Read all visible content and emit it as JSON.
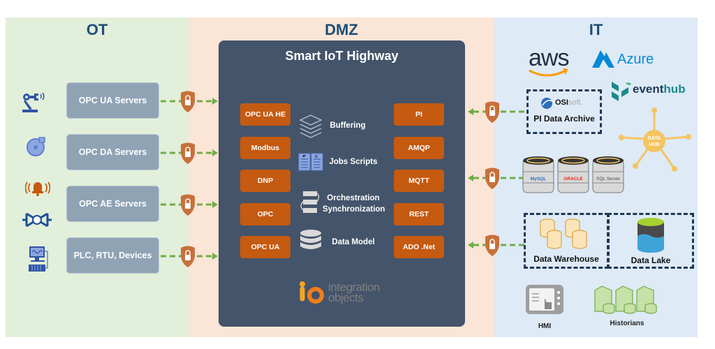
{
  "zones": {
    "ot": "OT",
    "dmz": "DMZ",
    "it": "IT"
  },
  "hub": {
    "title": "Smart IoT Highway",
    "left_protocols": [
      "OPC UA HE",
      "Modbus",
      "DNP",
      "OPC",
      "OPC UA"
    ],
    "right_protocols": [
      "PI",
      "AMQP",
      "MQTT",
      "REST",
      "ADO .Net"
    ],
    "features": [
      {
        "label": "Buffering",
        "icon": "layers-icon"
      },
      {
        "label": "Jobs Scripts",
        "icon": "book-icon"
      },
      {
        "label": "Orchestration Synchronization",
        "icon": "flow-icon"
      },
      {
        "label": "Data Model",
        "icon": "database-icon"
      }
    ],
    "logo": {
      "line1": "integration",
      "line2": "objects",
      "mark": "io"
    }
  },
  "ot": {
    "servers": [
      "OPC UA Servers",
      "OPC DA Servers",
      "OPC AE Servers",
      "PLC, RTU, Devices"
    ],
    "device_icons": [
      "robot-arm-icon",
      "pump-icon",
      "alarm-bell-icon",
      "valve-icon",
      "computer-terminal-icon"
    ]
  },
  "it": {
    "cloud": {
      "aws": "aws",
      "azure": "Azure",
      "eventhub_a": "event",
      "eventhub_b": "hub"
    },
    "pi_archive": {
      "brand_a": "OSI",
      "brand_b": "soft.",
      "label": "PI Data Archive"
    },
    "data_hub": {
      "line1": "DATA",
      "line2": "HUB"
    },
    "databases": [
      "MySQL",
      "ORACLE",
      "SQL Server"
    ],
    "warehouse": "Data Warehouse",
    "lake": "Data Lake",
    "hmi": "HMI",
    "historians": "Historians"
  },
  "colors": {
    "ot_bg": "#e2efda",
    "dmz_bg": "#fbe5d6",
    "it_bg": "#deeaf6",
    "hub_bg": "#44546a",
    "protocol": "#c55a11",
    "connector": "#70ad47",
    "shield": "#c8703a",
    "title": "#1f4e79"
  }
}
